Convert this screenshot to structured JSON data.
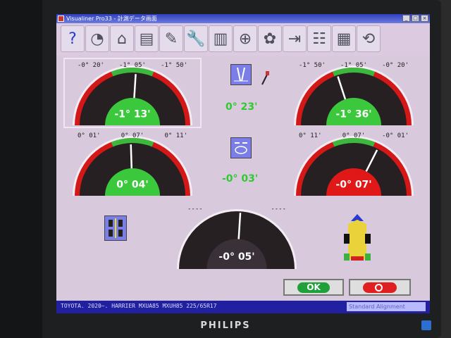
{
  "window": {
    "title": "Visualiner Pro33 - 計測データ画面"
  },
  "toolbar": {
    "items": [
      {
        "name": "help",
        "glyph": "?"
      },
      {
        "name": "gauge",
        "glyph": "◔"
      },
      {
        "name": "home",
        "glyph": "⌂"
      },
      {
        "name": "print",
        "glyph": "▤"
      },
      {
        "name": "calibrate",
        "glyph": "✎"
      },
      {
        "name": "adjust",
        "glyph": "🔧"
      },
      {
        "name": "spec",
        "glyph": "▥"
      },
      {
        "name": "zoom",
        "glyph": "⊕"
      },
      {
        "name": "wheels",
        "glyph": "✿"
      },
      {
        "name": "export",
        "glyph": "⇥"
      },
      {
        "name": "report",
        "glyph": "☷"
      },
      {
        "name": "vehicle-data",
        "glyph": "▦"
      },
      {
        "name": "settings",
        "glyph": "⟲"
      }
    ]
  },
  "gauges": {
    "front_left": {
      "left": "-0° 20'",
      "center": "-1° 05'",
      "right": "-1° 50'",
      "value": "-1° 13'",
      "color": "#3cc83c"
    },
    "front_right": {
      "left": "-1° 50'",
      "center": "-1° 05'",
      "right": "-0° 20'",
      "value": "-1° 36'",
      "color": "#3cc83c"
    },
    "rear_left": {
      "left": "0° 01'",
      "center": "0° 07'",
      "right": "0° 11'",
      "value": "0° 04'",
      "color": "#3cc83c"
    },
    "rear_right": {
      "left": "0° 11'",
      "center": "0° 07'",
      "right": "-0° 01'",
      "value": "-0° 07'",
      "color": "#e01818"
    },
    "bottom": {
      "left": "----",
      "right": "----",
      "value": "-0° 05'",
      "color": "#3a3038"
    }
  },
  "center_values": {
    "top": "0° 23'",
    "middle": "-0° 03'"
  },
  "buttons": {
    "ok": "OK"
  },
  "status": {
    "vehicle": "TOYOTA. 2020~. HARRIER MXUA85 MXUH85 225/65R17",
    "mode": "Standard Alignment"
  },
  "brand": "PHILIPS"
}
